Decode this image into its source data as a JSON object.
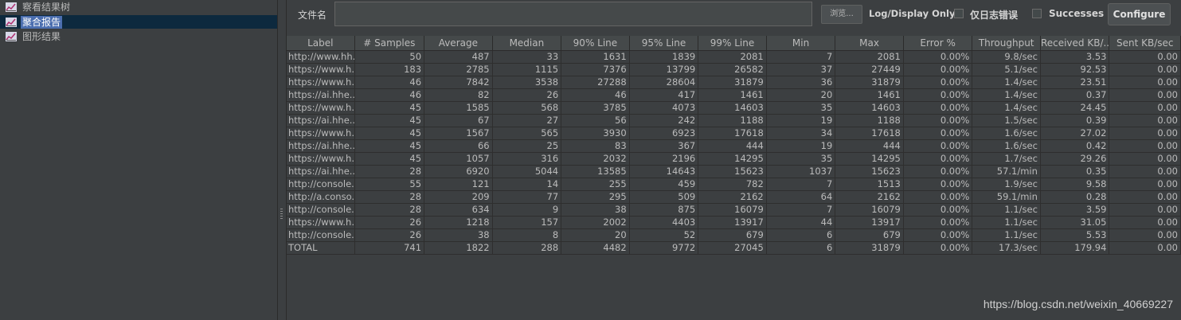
{
  "tree": {
    "items": [
      {
        "label": "察看结果树",
        "icon": "chart-icon",
        "selected": false
      },
      {
        "label": "聚合报告",
        "icon": "chart-icon",
        "selected": true
      },
      {
        "label": "图形结果",
        "icon": "chart-icon",
        "selected": false
      }
    ]
  },
  "filebar": {
    "filename_label": "文件名",
    "filename_value": "",
    "browse_label": "浏览...",
    "log_display_label": "Log/Display Only:",
    "errors_only_label": "仅日志错误",
    "errors_only_checked": false,
    "successes_label": "Successes",
    "successes_checked": false,
    "configure_label": "Configure"
  },
  "table": {
    "columns": [
      "Label",
      "# Samples",
      "Average",
      "Median",
      "90% Line",
      "95% Line",
      "99% Line",
      "Min",
      "Max",
      "Error %",
      "Throughput",
      "Received KB/...",
      "Sent KB/sec"
    ],
    "rows": [
      [
        "http://www.hh...",
        "50",
        "487",
        "33",
        "1631",
        "1839",
        "2081",
        "7",
        "2081",
        "0.00%",
        "9.8/sec",
        "3.53",
        "0.00"
      ],
      [
        "https://www.h...",
        "183",
        "2785",
        "1115",
        "7376",
        "13799",
        "26582",
        "37",
        "27449",
        "0.00%",
        "5.1/sec",
        "92.53",
        "0.00"
      ],
      [
        "https://www.h...",
        "46",
        "7842",
        "3538",
        "27288",
        "28604",
        "31879",
        "36",
        "31879",
        "0.00%",
        "1.4/sec",
        "23.51",
        "0.00"
      ],
      [
        "https://ai.hhe...",
        "46",
        "82",
        "26",
        "46",
        "417",
        "1461",
        "20",
        "1461",
        "0.00%",
        "1.4/sec",
        "0.37",
        "0.00"
      ],
      [
        "https://www.h...",
        "45",
        "1585",
        "568",
        "3785",
        "4073",
        "14603",
        "35",
        "14603",
        "0.00%",
        "1.4/sec",
        "24.45",
        "0.00"
      ],
      [
        "https://ai.hhe...",
        "45",
        "67",
        "27",
        "56",
        "242",
        "1188",
        "19",
        "1188",
        "0.00%",
        "1.5/sec",
        "0.39",
        "0.00"
      ],
      [
        "https://www.h...",
        "45",
        "1567",
        "565",
        "3930",
        "6923",
        "17618",
        "34",
        "17618",
        "0.00%",
        "1.6/sec",
        "27.02",
        "0.00"
      ],
      [
        "https://ai.hhe...",
        "45",
        "66",
        "25",
        "83",
        "367",
        "444",
        "19",
        "444",
        "0.00%",
        "1.6/sec",
        "0.42",
        "0.00"
      ],
      [
        "https://www.h...",
        "45",
        "1057",
        "316",
        "2032",
        "2196",
        "14295",
        "35",
        "14295",
        "0.00%",
        "1.7/sec",
        "29.26",
        "0.00"
      ],
      [
        "https://ai.hhe...",
        "28",
        "6920",
        "5044",
        "13585",
        "14643",
        "15623",
        "1037",
        "15623",
        "0.00%",
        "57.1/min",
        "0.35",
        "0.00"
      ],
      [
        "http://console...",
        "55",
        "121",
        "14",
        "255",
        "459",
        "782",
        "7",
        "1513",
        "0.00%",
        "1.9/sec",
        "9.58",
        "0.00"
      ],
      [
        "http://a.conso...",
        "28",
        "209",
        "77",
        "295",
        "509",
        "2162",
        "64",
        "2162",
        "0.00%",
        "59.1/min",
        "0.28",
        "0.00"
      ],
      [
        "http://console...",
        "28",
        "634",
        "9",
        "38",
        "875",
        "16079",
        "7",
        "16079",
        "0.00%",
        "1.1/sec",
        "3.59",
        "0.00"
      ],
      [
        "https://www.h...",
        "26",
        "1218",
        "157",
        "2002",
        "4403",
        "13917",
        "44",
        "13917",
        "0.00%",
        "1.1/sec",
        "31.05",
        "0.00"
      ],
      [
        "http://console...",
        "26",
        "38",
        "8",
        "20",
        "52",
        "679",
        "6",
        "679",
        "0.00%",
        "1.1/sec",
        "5.53",
        "0.00"
      ],
      [
        "TOTAL",
        "741",
        "1822",
        "288",
        "4482",
        "9772",
        "27045",
        "6",
        "31879",
        "0.00%",
        "17.3/sec",
        "179.94",
        "0.00"
      ]
    ]
  },
  "watermark": "https://blog.csdn.net/weixin_40669227"
}
